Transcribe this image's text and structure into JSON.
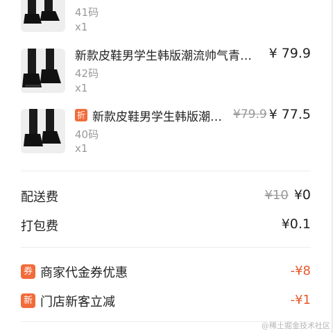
{
  "products": [
    {
      "name": "",
      "size": "41码",
      "qty": "x1",
      "price": "",
      "original_price": "",
      "tag": ""
    },
    {
      "name": "新款皮鞋男学生韩版潮流帅气青…",
      "size": "42码",
      "qty": "x1",
      "price": "¥ 79.9",
      "original_price": "",
      "tag": ""
    },
    {
      "name": "新款皮鞋男学生韩版潮…",
      "size": "40码",
      "qty": "x1",
      "price": "¥ 77.5",
      "original_price": "¥79.9",
      "tag": "折"
    }
  ],
  "fees": {
    "delivery_label": "配送费",
    "delivery_original": "¥10",
    "delivery_value": "¥0",
    "packing_label": "打包费",
    "packing_value": "¥0.1"
  },
  "promotions": [
    {
      "badge": "券",
      "label": "商家代金券优惠",
      "value": "-¥8"
    },
    {
      "badge": "新",
      "label": "门店新客立减",
      "value": "-¥1"
    }
  ],
  "watermark": "@稀土掘金技术社区",
  "colors": {
    "accent": "#f26b3a",
    "discount_text": "#e8582c",
    "muted": "#999999"
  }
}
